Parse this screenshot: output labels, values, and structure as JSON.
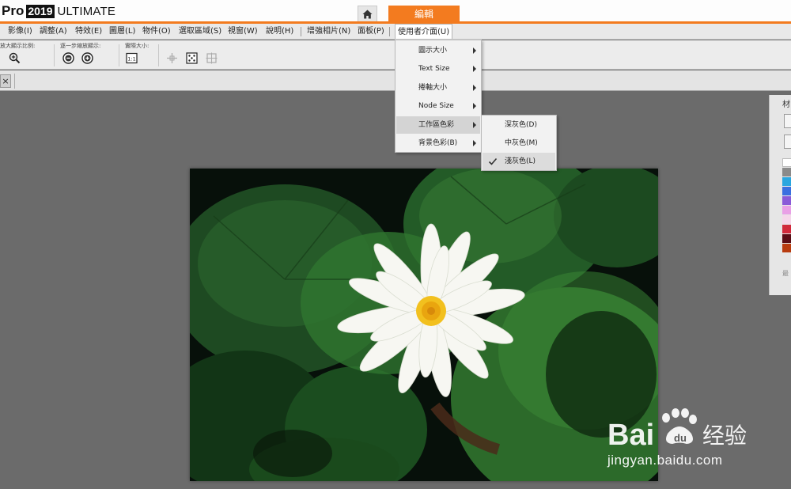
{
  "app": {
    "brand_pro": "Pro",
    "brand_year": "2019",
    "brand_edition": "ULTIMATE",
    "home_icon": "home-icon",
    "edit_tab_label": "編輯"
  },
  "menubar": {
    "items": [
      "影像(I)",
      "調整(A)",
      "特效(E)",
      "圖層(L)",
      "物件(O)",
      "選取區域(S)",
      "視窗(W)",
      "說明(H)",
      "增強相片(N)",
      "面板(P)",
      "使用者介面(U)"
    ]
  },
  "toolbar": {
    "zoom_ratio_label": "放大顯示比例:",
    "step_zoom_label": "逐一步縮放顯示:",
    "actual_size_label": "實際大小:",
    "icons": [
      "zoom-in-icon",
      "zoom-out-circle-icon",
      "zoom-in-circle-icon",
      "actual-size-icon",
      "pan-icon",
      "fit-screen-icon",
      "center-icon"
    ]
  },
  "document": {
    "close_label": "×"
  },
  "dropdown": {
    "items": [
      {
        "label": "圖示大小",
        "has_submenu": true
      },
      {
        "label": "Text Size",
        "has_submenu": true
      },
      {
        "label": "捲軸大小",
        "has_submenu": true
      },
      {
        "label": "Node Size",
        "has_submenu": true
      },
      {
        "label": "工作區色彩",
        "has_submenu": true,
        "highlighted": true
      },
      {
        "label": "背景色彩(B)",
        "has_submenu": true
      }
    ]
  },
  "submenu": {
    "items": [
      {
        "label": "深灰色(D)",
        "checked": false
      },
      {
        "label": "中灰色(M)",
        "checked": false
      },
      {
        "label": "淺灰色(L)",
        "checked": true
      }
    ]
  },
  "right_panel": {
    "title": "材",
    "swatches": [
      "#ffffff",
      "#8a8a8a",
      "#2aa6df",
      "#3a6fe0",
      "#8a5ad8",
      "#e9a0e6",
      "#f5d7ea",
      "#d12a3c",
      "#5a0d16",
      "#b83c10"
    ],
    "footer": "最"
  },
  "watermark": {
    "brand_text": "Bai",
    "brand_text2": "经验",
    "url": "jingyan.baidu.com"
  },
  "colors": {
    "accent": "#f37b1f",
    "workspace": "#6b6b6b",
    "menu_bg": "#e9e9e9"
  }
}
